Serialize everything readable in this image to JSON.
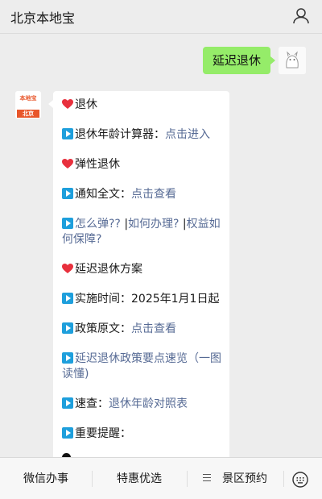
{
  "header": {
    "title": "北京本地宝"
  },
  "outgoing": {
    "text": "延迟退休"
  },
  "account": {
    "avatar_top": "本地宝",
    "avatar_bottom": "北京"
  },
  "message": {
    "l1": "退休",
    "l2_label": "退休年龄计算器：",
    "l2_link": "点击进入",
    "l3": "弹性退休",
    "l4_label": "通知全文：",
    "l4_link": "点击查看",
    "l5_link1": "怎么弹??",
    "l5_sep1": " |",
    "l5_link2": "如何办理?",
    "l5_sep2": " |",
    "l5_link3": "权益如何保障?",
    "l6": "延迟退休方案",
    "l7": "实施时间：2025年1月1日起",
    "l8_label": "政策原文：",
    "l8_link": "点击查看",
    "l9_link": "延迟退休政策要点速览（一图读懂)",
    "l10_label": "速查：",
    "l10_link": "退休年龄对照表",
    "l11": "重要提醒："
  },
  "menu": {
    "item1": "微信办事",
    "item2": "特惠优选",
    "item3": "景区预约"
  },
  "colors": {
    "link": "#576b95",
    "outgoing_bubble": "#95ec69",
    "play_icon": "#1e9fdc",
    "heart_icon": "#e8303d"
  }
}
